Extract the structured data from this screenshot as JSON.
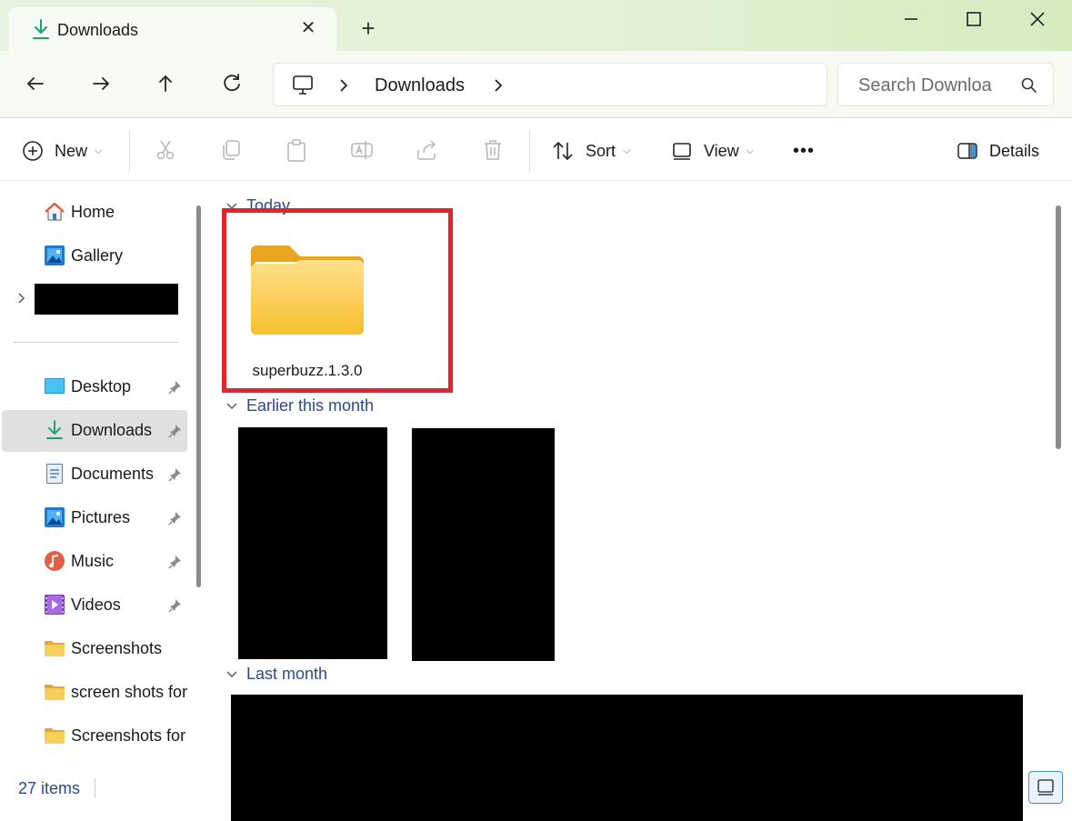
{
  "window": {
    "tab_title": "Downloads",
    "new_tab_label": "+"
  },
  "navigation": {
    "breadcrumb": [
      "Downloads"
    ],
    "search_placeholder": "Search Downloa"
  },
  "toolbar": {
    "new_label": "New",
    "sort_label": "Sort",
    "view_label": "View",
    "more_label": "•••",
    "details_label": "Details"
  },
  "sidebar": {
    "top_items": [
      {
        "label": "Home",
        "icon": "home-icon"
      },
      {
        "label": "Gallery",
        "icon": "gallery-icon"
      }
    ],
    "pinned_items": [
      {
        "label": "Desktop",
        "icon": "desktop-icon",
        "pinned": true
      },
      {
        "label": "Downloads",
        "icon": "download-icon",
        "pinned": true,
        "selected": true
      },
      {
        "label": "Documents",
        "icon": "documents-icon",
        "pinned": true
      },
      {
        "label": "Pictures",
        "icon": "pictures-icon",
        "pinned": true
      },
      {
        "label": "Music",
        "icon": "music-icon",
        "pinned": true
      },
      {
        "label": "Videos",
        "icon": "videos-icon",
        "pinned": true
      },
      {
        "label": "Screenshots",
        "icon": "folder-icon",
        "pinned": false
      },
      {
        "label": "screen shots for",
        "icon": "folder-icon",
        "pinned": false
      },
      {
        "label": "Screenshots for",
        "icon": "folder-icon",
        "pinned": false
      }
    ]
  },
  "content": {
    "groups": [
      {
        "label": "Today",
        "items": [
          {
            "name": "superbuzz.1.3.0",
            "type": "folder"
          }
        ]
      },
      {
        "label": "Earlier this month"
      },
      {
        "label": "Last month"
      }
    ]
  },
  "status": {
    "item_count": "27 items"
  },
  "colors": {
    "highlight": "#e3242b",
    "accent_link": "#2b4a8a",
    "folder": "#f7c948"
  }
}
